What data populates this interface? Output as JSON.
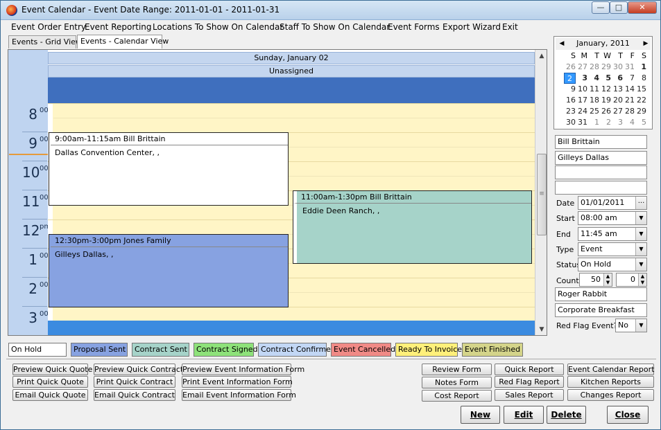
{
  "window": {
    "title": "Event Calendar - Event Date Range: 2011-01-01 - 2011-01-31",
    "min_glyph": "—",
    "max_glyph": "□",
    "close_glyph": "✕"
  },
  "menu": [
    "Event Order Entry",
    "Event Reporting",
    "Locations To Show On Calendar",
    "Staff To Show On Calendar",
    "Event Forms",
    "Export Wizard",
    "Exit"
  ],
  "tabs": [
    "Events - Grid View",
    "Events - Calendar View"
  ],
  "calendar": {
    "day_header": "Sunday, January 02",
    "column_header": "Unassigned",
    "hours": [
      {
        "num": "8",
        "suffix": "00"
      },
      {
        "num": "9",
        "suffix": "00"
      },
      {
        "num": "10",
        "suffix": "00"
      },
      {
        "num": "11",
        "suffix": "00"
      },
      {
        "num": "12",
        "suffix": "pm"
      },
      {
        "num": "1",
        "suffix": "00"
      },
      {
        "num": "2",
        "suffix": "00"
      },
      {
        "num": "3",
        "suffix": "00"
      }
    ],
    "events": [
      {
        "header": "9:00am-11:15am Bill Brittain",
        "body": "Dallas Convention Center, ,",
        "color": "#ffffff"
      },
      {
        "header": "11:00am-1:30pm Bill Brittain",
        "body": "Eddie Deen Ranch, ,",
        "color": "#a6d3c9"
      },
      {
        "header": "12:30pm-3:00pm Jones Family",
        "body": "Gilleys Dallas, ,",
        "color": "#87a2e1"
      }
    ],
    "scroll_up": "▲",
    "scroll_down": "▼",
    "scroll_grip": "≡"
  },
  "mini_calendar": {
    "month": "January, 2011",
    "prev": "◀",
    "next": "▶",
    "dow": [
      "S",
      "M",
      "T",
      "W",
      "T",
      "F",
      "S"
    ],
    "weeks": [
      [
        "26",
        "27",
        "28",
        "29",
        "30",
        "31",
        "1"
      ],
      [
        "2",
        "3",
        "4",
        "5",
        "6",
        "7",
        "8"
      ],
      [
        "9",
        "10",
        "11",
        "12",
        "13",
        "14",
        "15"
      ],
      [
        "16",
        "17",
        "18",
        "19",
        "20",
        "21",
        "22"
      ],
      [
        "23",
        "24",
        "25",
        "26",
        "27",
        "28",
        "29"
      ],
      [
        "30",
        "31",
        "1",
        "2",
        "3",
        "4",
        "5"
      ]
    ]
  },
  "details": {
    "field1": "Bill Brittain",
    "field2": "Gilleys Dallas",
    "field3": "",
    "field4": "",
    "date_label": "Date",
    "date_value": "01/01/2011",
    "date_btn": "...",
    "start_label": "Start",
    "start_value": "08:00 am",
    "end_label": "End",
    "end_value": "11:45 am",
    "type_label": "Type",
    "type_value": "Event",
    "status_label": "Status",
    "status_value": "On Hold",
    "counts_label": "Counts",
    "count1": "50",
    "count2": "0",
    "field5": "Roger Rabbit",
    "field6": "Corporate Breakfast",
    "red_flag_label": "Red Flag Event?",
    "red_flag_value": "No",
    "dropdown_arrow": "▼",
    "spin_up": "▲",
    "spin_down": "▼"
  },
  "legend": [
    {
      "label": "On Hold",
      "color": "#ffffff"
    },
    {
      "label": "Proposal Sent",
      "color": "#87a2e1"
    },
    {
      "label": "Contract Sent",
      "color": "#a6d3c9"
    },
    {
      "label": "Contract Signed",
      "color": "#8ee27a"
    },
    {
      "label": "Contract Confirmed",
      "color": "#c2d7f5"
    },
    {
      "label": "Event Cancelled",
      "color": "#f08a86"
    },
    {
      "label": "Ready To Invoice",
      "color": "#fff07a"
    },
    {
      "label": "Event Finished",
      "color": "#d4d48a"
    }
  ],
  "buttons": {
    "preview_quick_quote": "Preview Quick Quote",
    "print_quick_quote": "Print Quick Quote",
    "email_quick_quote": "Email Quick Quote",
    "preview_quick_contract": "Preview Quick Contract",
    "print_quick_contract": "Print Quick Contract",
    "email_quick_contract": "Email Quick Contract",
    "preview_event_info": "Preview Event Information Form",
    "print_event_info": "Print Event Information Form",
    "email_event_info": "Email Event Information Form",
    "review_form": "Review Form",
    "notes_form": "Notes Form",
    "cost_report": "Cost Report",
    "quick_report": "Quick Report",
    "red_flag_report": "Red Flag Report",
    "sales_report": "Sales Report",
    "event_calendar_report": "Event Calendar Report",
    "kitchen_reports": "Kitchen Reports",
    "changes_report": "Changes Report",
    "new": "New",
    "edit": "Edit",
    "delete": "Delete",
    "close": "Close"
  }
}
